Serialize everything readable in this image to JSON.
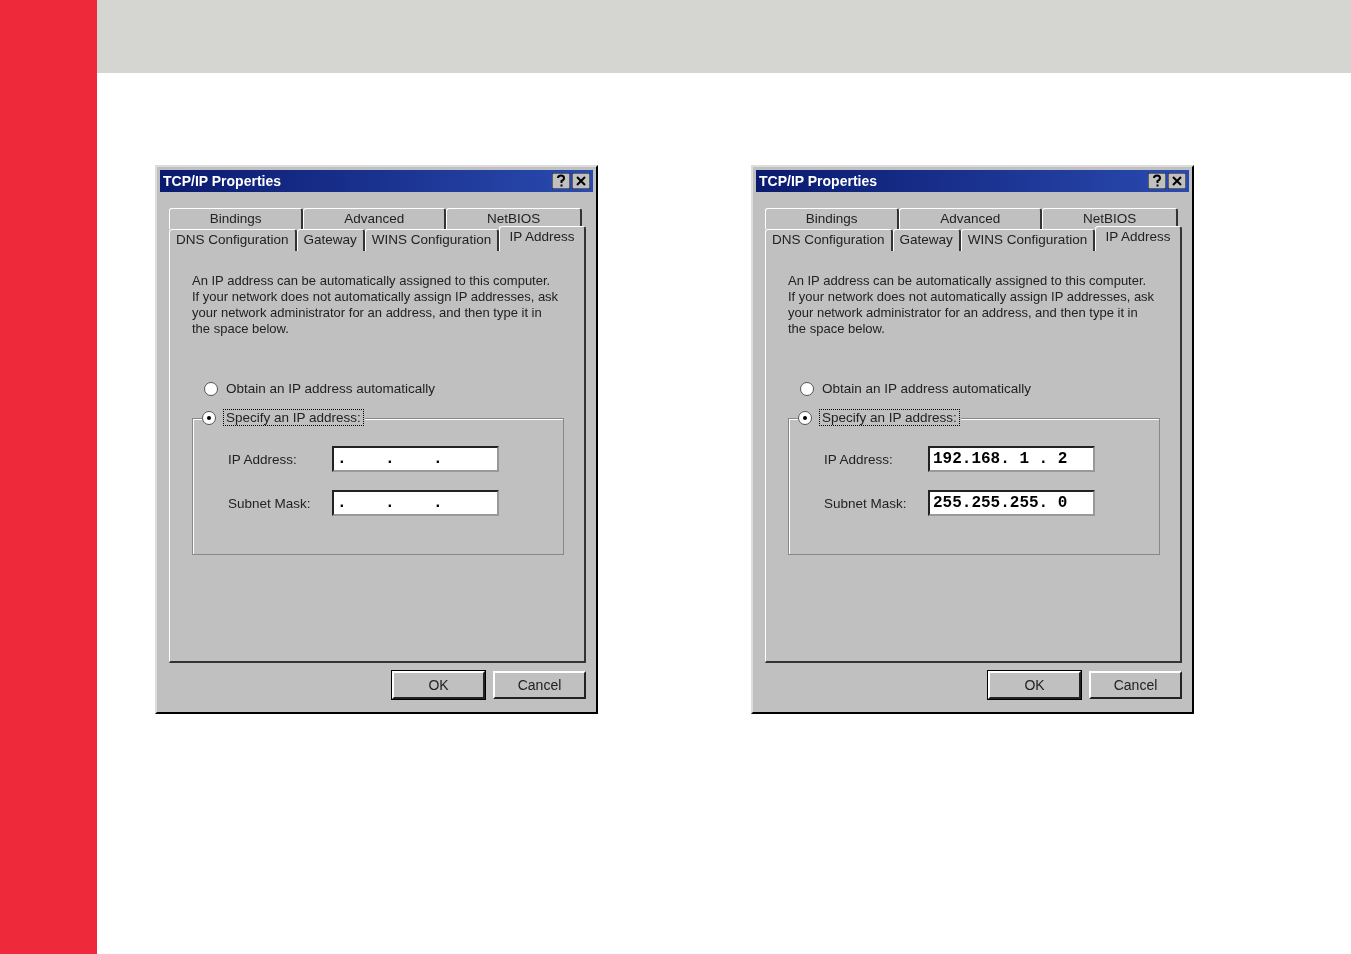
{
  "dialogs": [
    {
      "title": "TCP/IP Properties",
      "tab_rows": [
        [
          {
            "label": "Bindings",
            "selected": false
          },
          {
            "label": "Advanced",
            "selected": false
          },
          {
            "label": "NetBIOS",
            "selected": false
          }
        ],
        [
          {
            "label": "DNS Configuration",
            "selected": false
          },
          {
            "label": "Gateway",
            "selected": false
          },
          {
            "label": "WINS Configuration",
            "selected": false
          },
          {
            "label": "IP Address",
            "selected": true
          }
        ]
      ],
      "description": "An IP address can be automatically assigned to this computer.\nIf your network does not automatically assign IP addresses, ask\nyour network administrator for an address, and then type it in\nthe space below.",
      "radios": [
        {
          "label": "Obtain an IP address automatically",
          "selected": false
        },
        {
          "label": "Specify an IP address:",
          "selected": true
        }
      ],
      "fields": [
        {
          "label": "IP Address:",
          "value": ".    .    ."
        },
        {
          "label": "Subnet Mask:",
          "value": ".    .    ."
        }
      ],
      "buttons": [
        "OK",
        "Cancel"
      ]
    },
    {
      "title": "TCP/IP Properties",
      "tab_rows": [
        [
          {
            "label": "Bindings",
            "selected": false
          },
          {
            "label": "Advanced",
            "selected": false
          },
          {
            "label": "NetBIOS",
            "selected": false
          }
        ],
        [
          {
            "label": "DNS Configuration",
            "selected": false
          },
          {
            "label": "Gateway",
            "selected": false
          },
          {
            "label": "WINS Configuration",
            "selected": false
          },
          {
            "label": "IP Address",
            "selected": true
          }
        ]
      ],
      "description": "An IP address can be automatically assigned to this computer.\nIf your network does not automatically assign IP addresses, ask\nyour network administrator for an address, and then type it in\nthe space below.",
      "radios": [
        {
          "label": "Obtain an IP address automatically",
          "selected": false
        },
        {
          "label": "Specify an IP address:",
          "selected": true
        }
      ],
      "fields": [
        {
          "label": "IP Address:",
          "value": "192.168. 1 . 2"
        },
        {
          "label": "Subnet Mask:",
          "value": "255.255.255. 0"
        }
      ],
      "buttons": [
        "OK",
        "Cancel"
      ]
    }
  ]
}
